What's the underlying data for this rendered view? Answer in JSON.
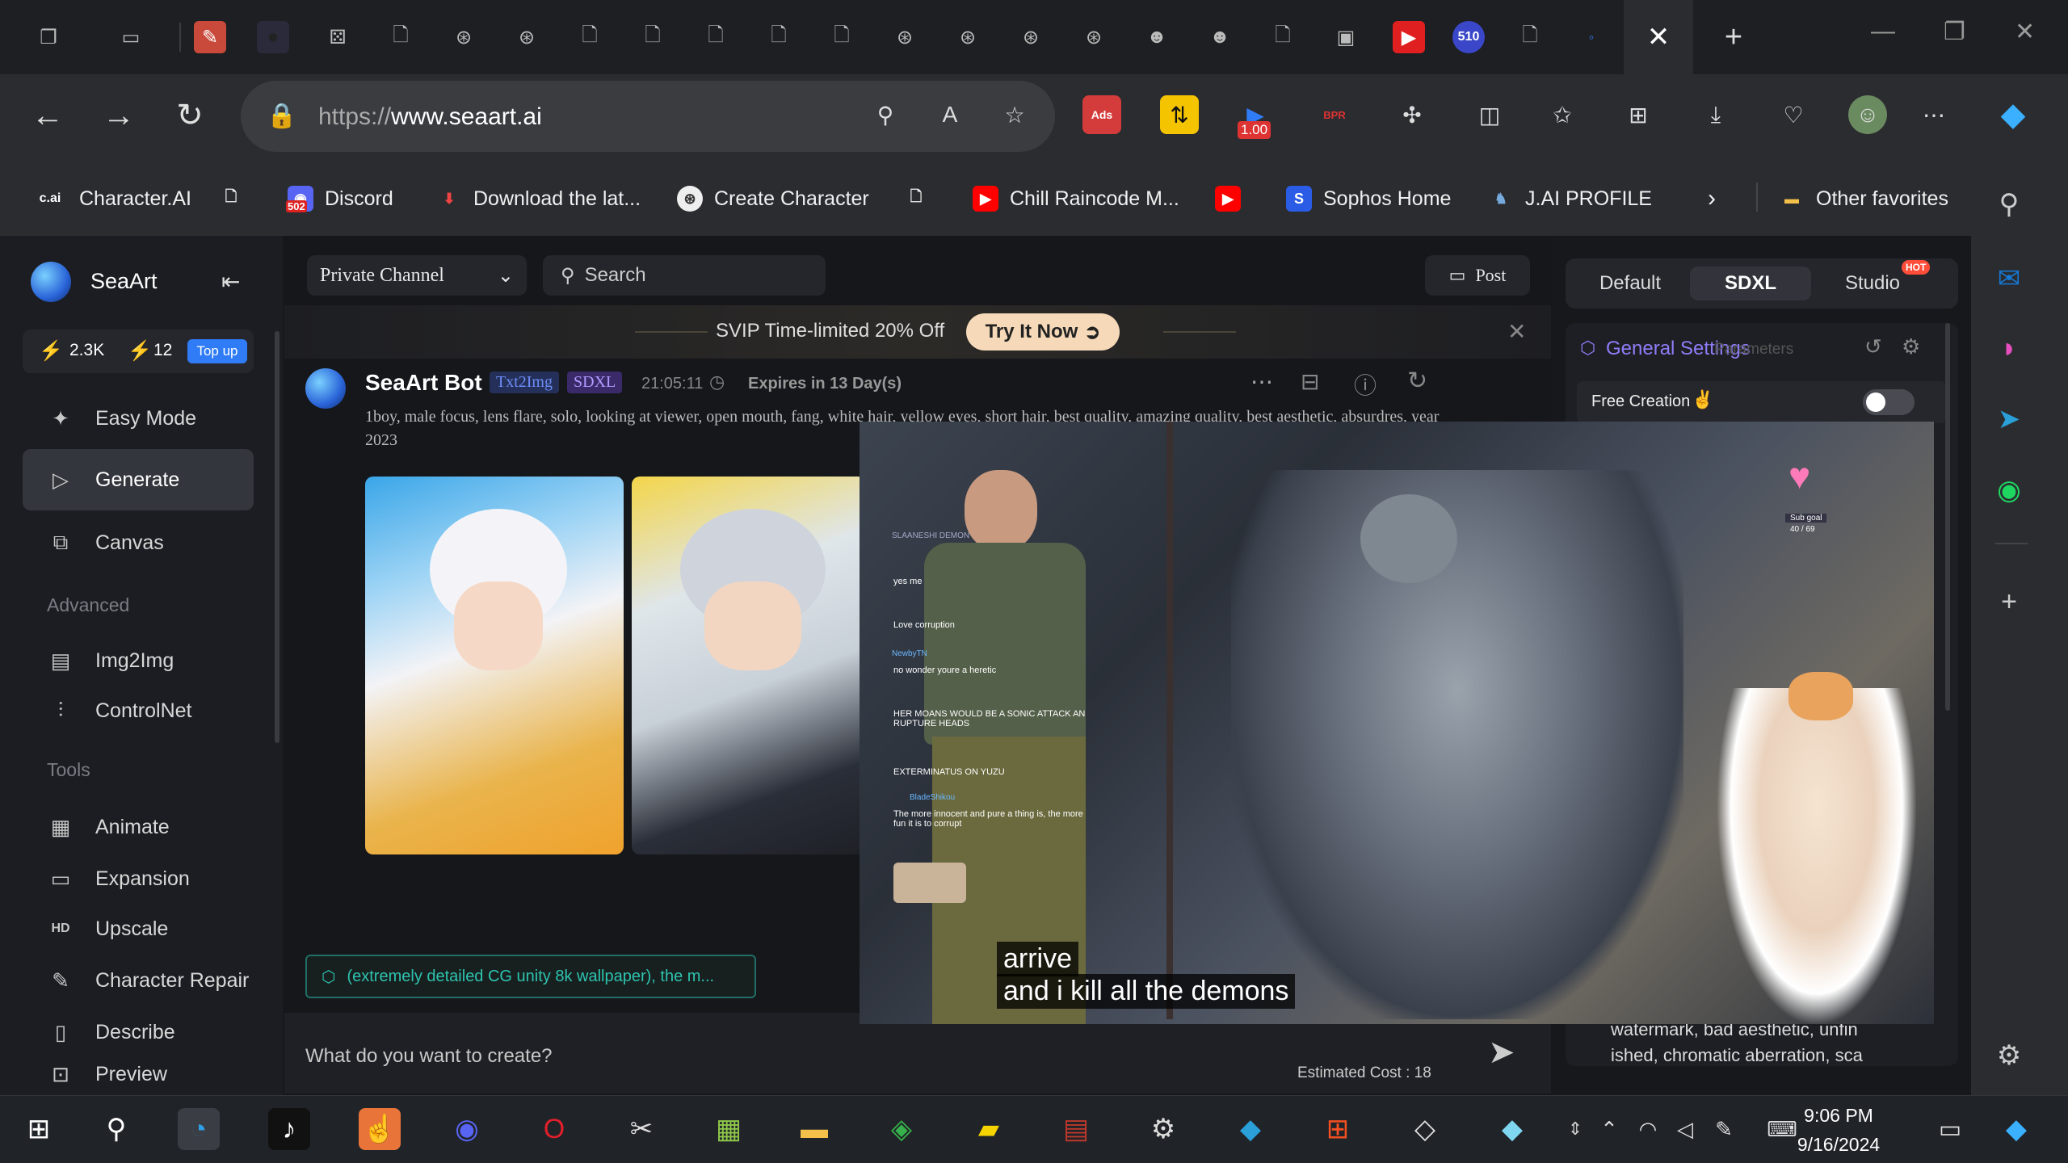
{
  "browser": {
    "tabs_count_badge": "510",
    "active_tab_close": "✕",
    "new_tab": "+",
    "url_prefix": "https://",
    "url_domain": "www.seaart.ai",
    "extension_badge_100": "1.00",
    "extension_ads": "Ads",
    "extension_bpr": "BPR",
    "favorites": [
      {
        "label": "Character.AI",
        "icon": "c.ai"
      },
      {
        "label": "",
        "icon": "page-icon"
      },
      {
        "label": "Discord",
        "icon": "discord-icon",
        "badge": "502"
      },
      {
        "label": "Download the lat...",
        "icon": "download-icon"
      },
      {
        "label": "Create Character",
        "icon": "seaart-icon"
      },
      {
        "label": "",
        "icon": "page-icon"
      },
      {
        "label": "Chill Raincode M...",
        "icon": "youtube-icon"
      },
      {
        "label": "",
        "icon": "youtube-icon"
      },
      {
        "label": "Sophos Home",
        "icon": "sophos-icon"
      },
      {
        "label": "J.AI PROFILE",
        "icon": "jai-icon"
      }
    ],
    "other_favorites": "Other favorites"
  },
  "seaart": {
    "brand": "SeaArt",
    "stats": {
      "energy": "2.3K",
      "bolts": "12",
      "topup": "Top up"
    },
    "nav": [
      {
        "label": "Easy Mode",
        "icon": "sparkle-icon"
      },
      {
        "label": "Generate",
        "icon": "play-icon",
        "active": true
      },
      {
        "label": "Canvas",
        "icon": "canvas-icon"
      }
    ],
    "section_advanced": "Advanced",
    "nav_advanced": [
      {
        "label": "Img2Img",
        "icon": "img2img-icon"
      },
      {
        "label": "ControlNet",
        "icon": "controlnet-icon"
      }
    ],
    "section_tools": "Tools",
    "nav_tools": [
      {
        "label": "Animate",
        "icon": "animate-icon"
      },
      {
        "label": "Expansion",
        "icon": "expansion-icon"
      },
      {
        "label": "Upscale",
        "icon": "hd-icon"
      },
      {
        "label": "Character Repair",
        "icon": "repair-icon"
      },
      {
        "label": "Describe",
        "icon": "describe-icon"
      },
      {
        "label": "Preview",
        "icon": "preview-icon"
      }
    ],
    "channel_select": "Private Channel",
    "search_placeholder": "Search",
    "post_button": "Post",
    "promo_text": "SVIP Time-limited 20% Off",
    "promo_button": "Try It Now",
    "message": {
      "author": "SeaArt Bot",
      "tag1": "Txt2Img",
      "tag2": "SDXL",
      "time": "21:05:11",
      "expires": "Expires in 13 Day(s)",
      "prompt": "1boy, male focus, lens flare, solo, looking at viewer, open mouth, fang, white hair, yellow eyes, short hair, best quality, amazing quality, best aesthetic, absurdres, year 2023"
    },
    "prompt_chip": "(extremely detailed CG unity 8k wallpaper), the m...",
    "input_placeholder": "What do you want to create?",
    "estimated_cost": "Estimated Cost : 18",
    "panel_tabs": {
      "default": "Default",
      "sdxl": "SDXL",
      "studio": "Studio",
      "hot": "HOT"
    },
    "general_settings": "General Settings",
    "parameters": "Parameters",
    "free_creation": "Free Creation",
    "negative_text_1": "watermark, bad aesthetic, unfin",
    "negative_text_2": "ished, chromatic aberration, sca"
  },
  "video": {
    "subtitle_1": "arrive",
    "subtitle_2": "and i kill all the demons",
    "sub_goal": "Sub goal",
    "sub_goal_count": "40 / 69",
    "chat": [
      {
        "name": "SLAANESHI DEMON",
        "text": "yes me"
      },
      {
        "name": "",
        "text": "Love corruption"
      },
      {
        "name": "NewbyTN",
        "text": "no wonder youre a heretic"
      },
      {
        "name": "",
        "text": "HER MOANS WOULD BE A SONIC ATTACK AN RUPTURE HEADS"
      },
      {
        "name": "",
        "text": "EXTERMINATUS ON YUZU"
      },
      {
        "name": "BladeShikou",
        "text": "The more innocent and pure a thing is, the more fun it is to corrupt"
      }
    ]
  },
  "taskbar": {
    "time": "9:06 PM",
    "date": "9/16/2024"
  },
  "colors": {
    "accent_blue": "#2f7cf6",
    "seaart_purple": "#6b6cf5",
    "promo_orange": "#f5d9b8",
    "youtube_red": "#ff0000"
  }
}
